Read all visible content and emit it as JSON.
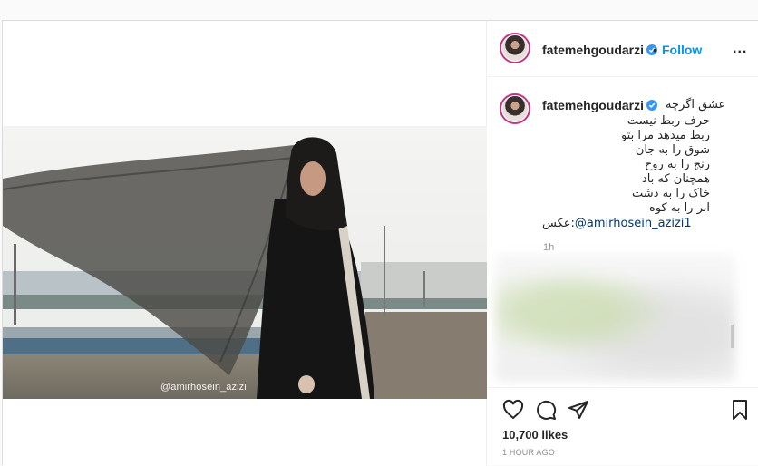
{
  "post": {
    "username": "fatemehgoudarzi",
    "follow_label": "Follow",
    "separator": "•",
    "more_label": "...",
    "photo_credit_overlay": "@amirhosein_azizi",
    "caption": {
      "username": "fatemehgoudarzi",
      "lines": [
        "عشق اگرچه",
        "حرف ربط نیست",
        "ربط میدهد مرا بتو",
        "شوق را به جان",
        "رنج را به روح",
        "همچنان که باد",
        "خاک را به دشت",
        "ابر را به کوه"
      ],
      "credit_prefix": "عکس:",
      "credit_mention": "@amirhosein_azizi1",
      "time": "1h"
    },
    "likes": "10,700 likes",
    "posted": "1 HOUR AGO"
  },
  "icons": [
    "verified-badge-icon",
    "heart-icon",
    "comment-icon",
    "share-icon",
    "bookmark-icon",
    "more-options-icon"
  ],
  "colors": {
    "accent": "#0095f6",
    "mention": "#00376b",
    "muted": "#8e8e8e"
  }
}
